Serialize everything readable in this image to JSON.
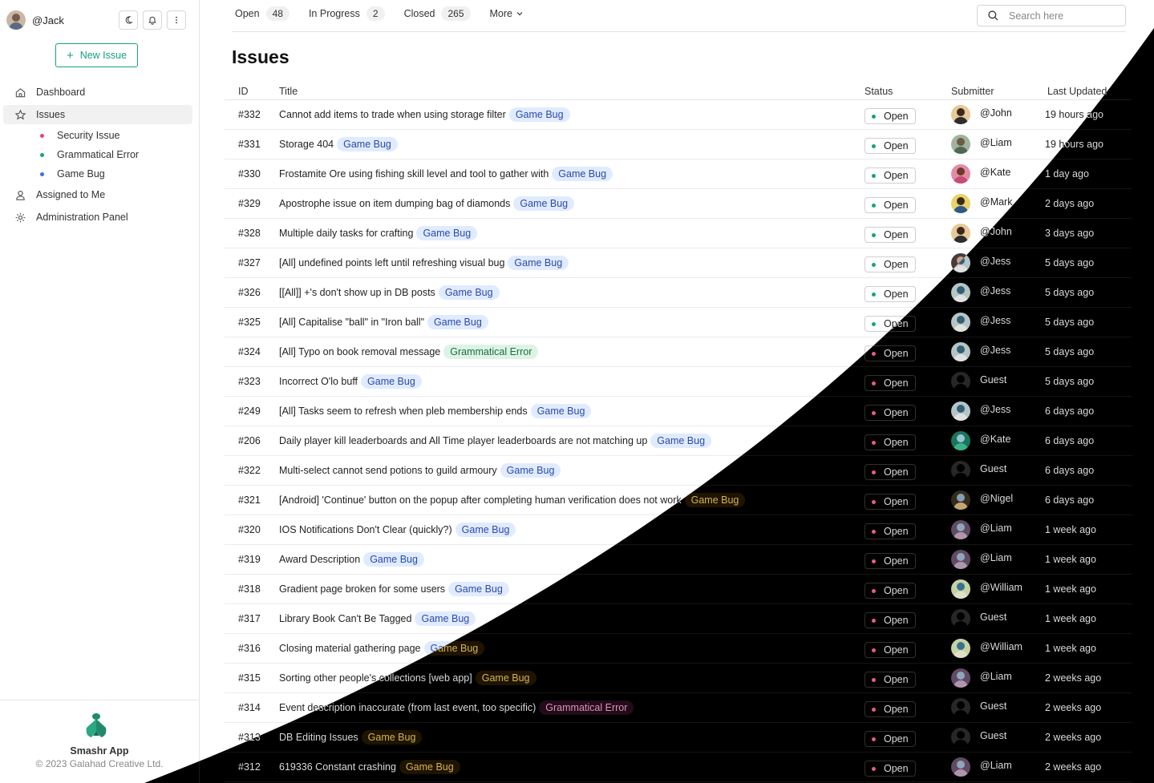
{
  "user": {
    "handle": "@Jack"
  },
  "sidebar": {
    "new_issue_label": "New Issue",
    "items": [
      {
        "label": "Dashboard",
        "icon": "home-icon"
      },
      {
        "label": "Issues",
        "icon": "star-icon"
      },
      {
        "label": "Assigned to Me",
        "icon": "user-icon"
      },
      {
        "label": "Administration Panel",
        "icon": "gear-icon"
      }
    ],
    "sub_items": [
      {
        "label": "Security Issue",
        "color": "#e0457b"
      },
      {
        "label": "Grammatical Error",
        "color": "#14a37f"
      },
      {
        "label": "Game Bug",
        "color": "#3b6fe0"
      }
    ],
    "footer": {
      "app_name": "Smashr App",
      "copyright": "© 2023 Galahad Creative Ltd."
    }
  },
  "tabs": [
    {
      "label": "Open",
      "count": "48"
    },
    {
      "label": "In Progress",
      "count": "2"
    },
    {
      "label": "Closed",
      "count": "265"
    }
  ],
  "more_label": "More",
  "search": {
    "placeholder": "Search here"
  },
  "page_title": "Issues",
  "columns": {
    "id": "ID",
    "title": "Title",
    "status": "Status",
    "submitter": "Submitter",
    "updated": "Last Updated"
  },
  "colors": {
    "accent": "#14a37f",
    "open_dot": "#1aa36f",
    "game_tag_bg": "#e0ebff",
    "gram_tag_bg": "#ddf3e6"
  },
  "rows": [
    {
      "id": "#332",
      "title": "Cannot add items to trade when using storage filter",
      "tag": "Game Bug",
      "tag_type": "game",
      "status": "Open",
      "submitter": "@John",
      "avatar": "john",
      "updated": "19 hours ago"
    },
    {
      "id": "#331",
      "title": "Storage 404",
      "tag": "Game Bug",
      "tag_type": "game",
      "status": "Open",
      "submitter": "@Liam",
      "avatar": "liam",
      "updated": "19 hours ago"
    },
    {
      "id": "#330",
      "title": "Frostamite Ore using fishing skill level and tool to gather with",
      "tag": "Game Bug",
      "tag_type": "game",
      "status": "Open",
      "submitter": "@Kate",
      "avatar": "kate",
      "updated": "1 day ago"
    },
    {
      "id": "#329",
      "title": "Apostrophe issue on item dumping bag of diamonds",
      "tag": "Game Bug",
      "tag_type": "game",
      "status": "Open",
      "submitter": "@Mark",
      "avatar": "mark",
      "updated": "2 days ago"
    },
    {
      "id": "#328",
      "title": "Multiple daily tasks for crafting",
      "tag": "Game Bug",
      "tag_type": "game",
      "status": "Open",
      "submitter": "@John",
      "avatar": "john",
      "updated": "3 days ago"
    },
    {
      "id": "#327",
      "title": "[All] undefined points left until refreshing visual bug",
      "tag": "Game Bug",
      "tag_type": "game",
      "status": "Open",
      "submitter": "@Jess",
      "avatar": "jess",
      "updated": "5 days ago"
    },
    {
      "id": "#326",
      "title": "[[All]] +'s don't show up in DB posts",
      "tag": "Game Bug",
      "tag_type": "game",
      "status": "Open",
      "submitter": "@Jess",
      "avatar": "jess",
      "updated": "5 days ago"
    },
    {
      "id": "#325",
      "title": "[All] Capitalise \"ball\" in \"Iron ball\"",
      "tag": "Game Bug",
      "tag_type": "game",
      "status": "Open",
      "submitter": "@Jess",
      "avatar": "jess",
      "updated": "5 days ago"
    },
    {
      "id": "#324",
      "title": "[All] Typo on book removal message",
      "tag": "Grammatical Error",
      "tag_type": "gram",
      "status": "Open",
      "submitter": "@Jess",
      "avatar": "jess",
      "updated": "5 days ago"
    },
    {
      "id": "#323",
      "title": "Incorrect O'lo buff",
      "tag": "Game Bug",
      "tag_type": "game",
      "status": "Open",
      "submitter": "Guest",
      "avatar": "guest",
      "updated": "5 days ago"
    },
    {
      "id": "#249",
      "title": "[All] Tasks seem to refresh when pleb membership ends",
      "tag": "Game Bug",
      "tag_type": "game",
      "status": "Open",
      "submitter": "@Jess",
      "avatar": "jess",
      "updated": "6 days ago"
    },
    {
      "id": "#206",
      "title": "Daily player kill leaderboards and All Time player leaderboards are not matching up",
      "tag": "Game Bug",
      "tag_type": "game",
      "status": "Open",
      "submitter": "@Kate",
      "avatar": "kate",
      "updated": "6 days ago"
    },
    {
      "id": "#322",
      "title": "Multi-select cannot send potions to guild armoury",
      "tag": "Game Bug",
      "tag_type": "game",
      "status": "Open",
      "submitter": "Guest",
      "avatar": "guest",
      "updated": "6 days ago"
    },
    {
      "id": "#321",
      "title": "[Android] 'Continue' button on the popup after completing human verification does not work",
      "tag": "Game Bug",
      "tag_type": "game",
      "status": "Open",
      "submitter": "@Nigel",
      "avatar": "nigel",
      "updated": "6 days ago"
    },
    {
      "id": "#320",
      "title": "IOS Notifications Don't Clear (quickly?)",
      "tag": "Game Bug",
      "tag_type": "game",
      "status": "Open",
      "submitter": "@Liam",
      "avatar": "liam",
      "updated": "1 week ago"
    },
    {
      "id": "#319",
      "title": "Award Description",
      "tag": "Game Bug",
      "tag_type": "game",
      "status": "Open",
      "submitter": "@Liam",
      "avatar": "liam",
      "updated": "1 week ago"
    },
    {
      "id": "#318",
      "title": "Gradient page broken for some users",
      "tag": "Game Bug",
      "tag_type": "game",
      "status": "Open",
      "submitter": "@William",
      "avatar": "william",
      "updated": "1 week ago"
    },
    {
      "id": "#317",
      "title": "Library Book Can't Be Tagged",
      "tag": "Game Bug",
      "tag_type": "game",
      "status": "Open",
      "submitter": "Guest",
      "avatar": "guest",
      "updated": "1 week ago"
    },
    {
      "id": "#316",
      "title": "Closing material gathering page",
      "tag": "Game Bug",
      "tag_type": "game",
      "status": "Open",
      "submitter": "@William",
      "avatar": "william",
      "updated": "1 week ago"
    },
    {
      "id": "#315",
      "title": "Sorting other people's collections [web app]",
      "tag": "Game Bug",
      "tag_type": "game",
      "status": "Open",
      "submitter": "@Liam",
      "avatar": "liam",
      "updated": "2 weeks ago"
    },
    {
      "id": "#314",
      "title": "Event description inaccurate (from last event, too specific)",
      "tag": "Grammatical Error",
      "tag_type": "gram",
      "status": "Open",
      "submitter": "Guest",
      "avatar": "guest",
      "updated": "2 weeks ago"
    },
    {
      "id": "#313",
      "title": "DB Editing Issues",
      "tag": "Game Bug",
      "tag_type": "game",
      "status": "Open",
      "submitter": "Guest",
      "avatar": "guest",
      "updated": "2 weeks ago"
    },
    {
      "id": "#312",
      "title": "619336 Constant crashing",
      "tag": "Game Bug",
      "tag_type": "game",
      "status": "Open",
      "submitter": "@Liam",
      "avatar": "liam",
      "updated": "2 weeks ago"
    }
  ]
}
